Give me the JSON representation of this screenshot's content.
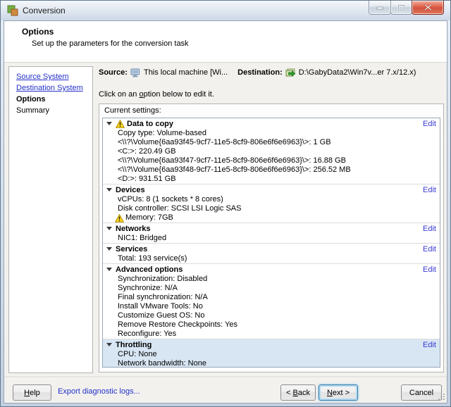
{
  "colors": {
    "highlight": "#d8e6f4",
    "edit_link": "#3a3ad2",
    "nav_link": "#2430c8",
    "warning": "#ffd61c",
    "close_red": "#d2523e"
  },
  "window": {
    "title": "Conversion"
  },
  "header": {
    "title": "Options",
    "subtitle": "Set up the parameters for the conversion task"
  },
  "sidebar": {
    "items": [
      {
        "label": "Source System",
        "type": "link"
      },
      {
        "label": "Destination System",
        "type": "link"
      },
      {
        "label": "Options",
        "type": "current"
      },
      {
        "label": "Summary",
        "type": "plain"
      }
    ]
  },
  "summary_bar": {
    "source_label": "Source:",
    "source_value": "This local machine [Wi...",
    "destination_label": "Destination:",
    "destination_value": "D:\\GabyData2\\Win7v...er 7.x/12.x)"
  },
  "instruction": {
    "pre": "Click on an ",
    "accel": "o",
    "post": "ption below to edit it."
  },
  "settings": {
    "label": "Current settings:",
    "edit_label": "Edit",
    "sections": [
      {
        "title": "Data to copy",
        "warning": true,
        "selected": false,
        "lines": [
          {
            "text": "Copy type: Volume-based"
          },
          {
            "text": "<\\\\?\\Volume{6aa93f45-9cf7-11e5-8cf9-806e6f6e6963}\\>: 1 GB"
          },
          {
            "text": "<C:>: 220.49 GB"
          },
          {
            "text": "<\\\\?\\Volume{6aa93f47-9cf7-11e5-8cf9-806e6f6e6963}\\>: 16.88 GB"
          },
          {
            "text": "<\\\\?\\Volume{6aa93f48-9cf7-11e5-8cf9-806e6f6e6963}\\>: 256.52 MB"
          },
          {
            "text": "<D:>: 931.51 GB"
          }
        ]
      },
      {
        "title": "Devices",
        "warning": false,
        "selected": false,
        "lines": [
          {
            "text": "vCPUs: 8 (1 sockets * 8 cores)"
          },
          {
            "text": "Disk controller: SCSI LSI Logic SAS"
          },
          {
            "text": "Memory: 7GB",
            "warning": true
          }
        ]
      },
      {
        "title": "Networks",
        "warning": false,
        "selected": false,
        "lines": [
          {
            "text": "NIC1: Bridged"
          }
        ]
      },
      {
        "title": "Services",
        "warning": false,
        "selected": false,
        "lines": [
          {
            "text": "Total: 193 service(s)"
          }
        ]
      },
      {
        "title": "Advanced options",
        "warning": false,
        "selected": false,
        "lines": [
          {
            "text": "Synchronization: Disabled"
          },
          {
            "text": "Synchronize: N/A"
          },
          {
            "text": "Final synchronization: N/A"
          },
          {
            "text": "Install VMware Tools: No"
          },
          {
            "text": "Customize Guest OS: No"
          },
          {
            "text": "Remove Restore Checkpoints: Yes"
          },
          {
            "text": "Reconfigure: Yes"
          }
        ]
      },
      {
        "title": "Throttling",
        "warning": false,
        "selected": true,
        "lines": [
          {
            "text": "CPU: None"
          },
          {
            "text": "Network bandwidth: None"
          }
        ]
      }
    ]
  },
  "footer": {
    "help": {
      "accel": "H",
      "post": "elp"
    },
    "export_link": "Export diagnostic logs...",
    "back": {
      "pre": "< ",
      "accel": "B",
      "post": "ack"
    },
    "next": {
      "accel": "N",
      "post": "ext >"
    },
    "cancel": "Cancel"
  }
}
